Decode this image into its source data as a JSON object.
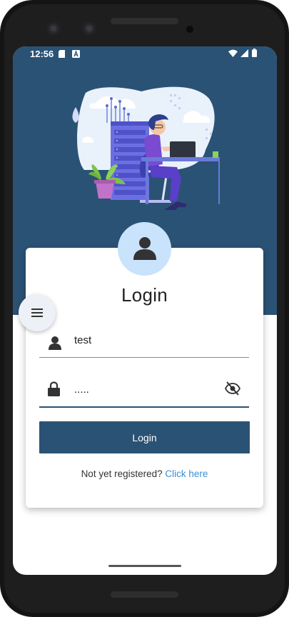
{
  "status_bar": {
    "time": "12:56"
  },
  "login": {
    "title": "Login",
    "username_value": "test",
    "password_value": ".....",
    "button_label": "Login",
    "register_prompt": "Not yet registered?",
    "register_link": "Click here"
  },
  "icons": {
    "sim": "sim-card-icon",
    "notification": "a-notification-icon",
    "wifi": "wifi-icon",
    "signal": "signal-icon",
    "battery": "battery-icon",
    "user": "user-icon",
    "lock": "lock-icon",
    "visibility": "visibility-off-icon",
    "menu": "menu-icon"
  },
  "colors": {
    "primary": "#2a5275",
    "link": "#3a8ed4",
    "avatar_bg": "#c8e3fb"
  }
}
